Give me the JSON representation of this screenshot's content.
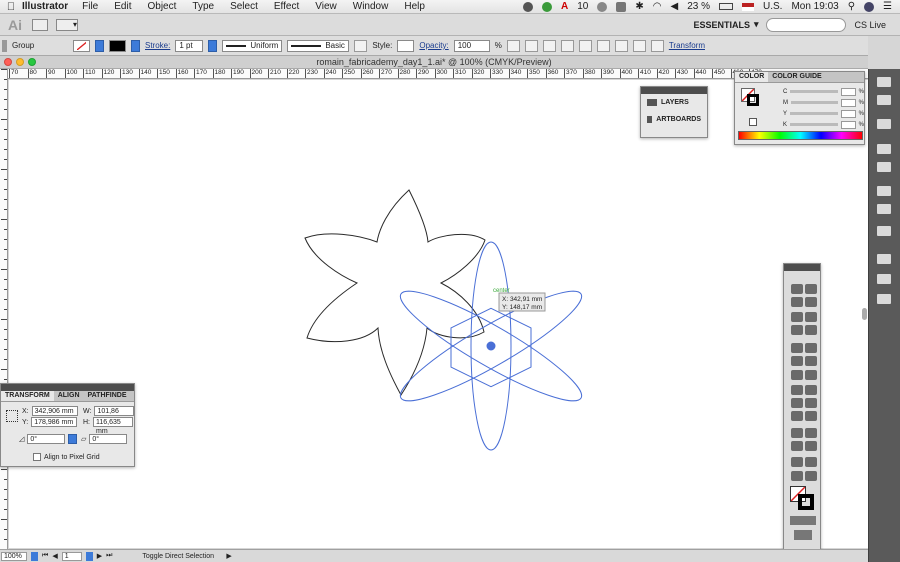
{
  "menubar": {
    "app_name": "Illustrator",
    "items": [
      "File",
      "Edit",
      "Object",
      "Type",
      "Select",
      "Effect",
      "View",
      "Window",
      "Help"
    ],
    "battery_text": "23 %",
    "input_source": "U.S.",
    "clock": "Mon 19:03",
    "adobe_count": "10"
  },
  "appbar": {
    "logo": "Ai",
    "workspace": "ESSENTIALS",
    "cs_live": "CS Live"
  },
  "controlbar": {
    "selection_type": "Group",
    "stroke_label": "Stroke:",
    "stroke_weight": "1 pt",
    "profile": "Uniform",
    "brush": "Basic",
    "style_label": "Style:",
    "opacity_label": "Opacity:",
    "opacity_value": "100",
    "percent": "%",
    "transform_label": "Transform"
  },
  "document": {
    "title": "romain_fabricademy_day1_1.ai* @ 100% (CMYK/Preview)"
  },
  "ruler": {
    "ticks": [
      "70",
      "80",
      "90",
      "100",
      "110",
      "120",
      "130",
      "140",
      "150",
      "160",
      "170",
      "180",
      "190",
      "200",
      "210",
      "220",
      "230",
      "240",
      "250",
      "260",
      "270",
      "280",
      "290",
      "300",
      "310",
      "320",
      "330",
      "340",
      "350",
      "360",
      "370",
      "380",
      "390",
      "400",
      "410",
      "420",
      "430",
      "440",
      "450",
      "460",
      "470"
    ]
  },
  "layers_panel": {
    "items": [
      "LAYERS",
      "ARTBOARDS"
    ]
  },
  "color_panel": {
    "tabs": [
      "COLOR",
      "COLOR GUIDE"
    ],
    "channels": [
      "C",
      "M",
      "Y",
      "K"
    ],
    "percent": "%"
  },
  "transform_panel": {
    "tabs": [
      "TRANSFORM",
      "ALIGN",
      "PATHFINDE"
    ],
    "x_label": "X:",
    "x_value": "342,906 mm",
    "y_label": "Y:",
    "y_value": "178,986 mm",
    "w_label": "W:",
    "w_value": "101,86 mm",
    "h_label": "H:",
    "h_value": "116,635 mm",
    "rotate_value": "0°",
    "shear_value": "0°",
    "pixel_grid_label": "Align to Pixel Grid"
  },
  "cursor_tooltip": {
    "x_text": "X: 342,91 mm",
    "y_text": "Y: 148,17 mm",
    "smart_guide": "center"
  },
  "statusbar": {
    "zoom": "100%",
    "artboard": "1",
    "status_text": "Toggle Direct Selection"
  },
  "colors": {
    "selection_blue": "#4a6fd6",
    "art_stroke": "#2a2a2a",
    "panel_dark": "#4d4d4d"
  }
}
